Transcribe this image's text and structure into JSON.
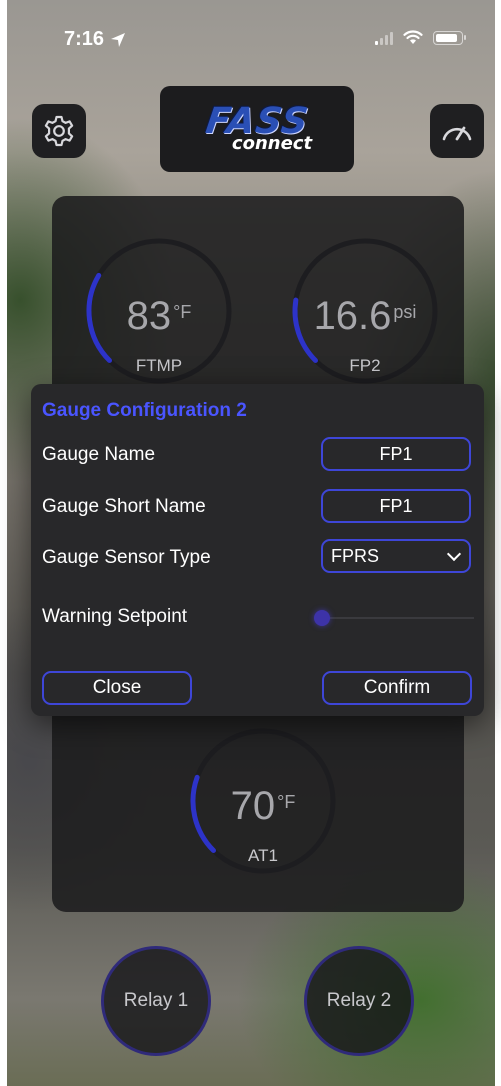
{
  "status_bar": {
    "time": "7:16"
  },
  "header": {
    "logo_text_1": "FASS",
    "logo_text_2": "connect"
  },
  "gauges": [
    {
      "value": "83",
      "unit": "°F",
      "label": "FTMP",
      "level": 0.28
    },
    {
      "value": "16.6",
      "unit": "psi",
      "label": "FP2",
      "level": 0.2
    },
    {
      "value": "70",
      "unit": "°F",
      "label": "AT1",
      "level": 0.24
    }
  ],
  "modal": {
    "title": "Gauge Configuration 2",
    "gauge_name_label": "Gauge Name",
    "gauge_name_value": "FP1",
    "short_name_label": "Gauge Short Name",
    "short_name_value": "FP1",
    "sensor_type_label": "Gauge Sensor Type",
    "sensor_type_value": "FPRS",
    "warning_label": "Warning Setpoint",
    "warning_level": 0.0,
    "close_label": "Close",
    "confirm_label": "Confirm"
  },
  "relays": [
    {
      "label": "Relay 1"
    },
    {
      "label": "Relay 2"
    }
  ],
  "colors": {
    "accent": "#3e46d8",
    "title": "#4a55ff",
    "gauge_arc": "#2d33c8",
    "panel": "#1c1c1e"
  }
}
